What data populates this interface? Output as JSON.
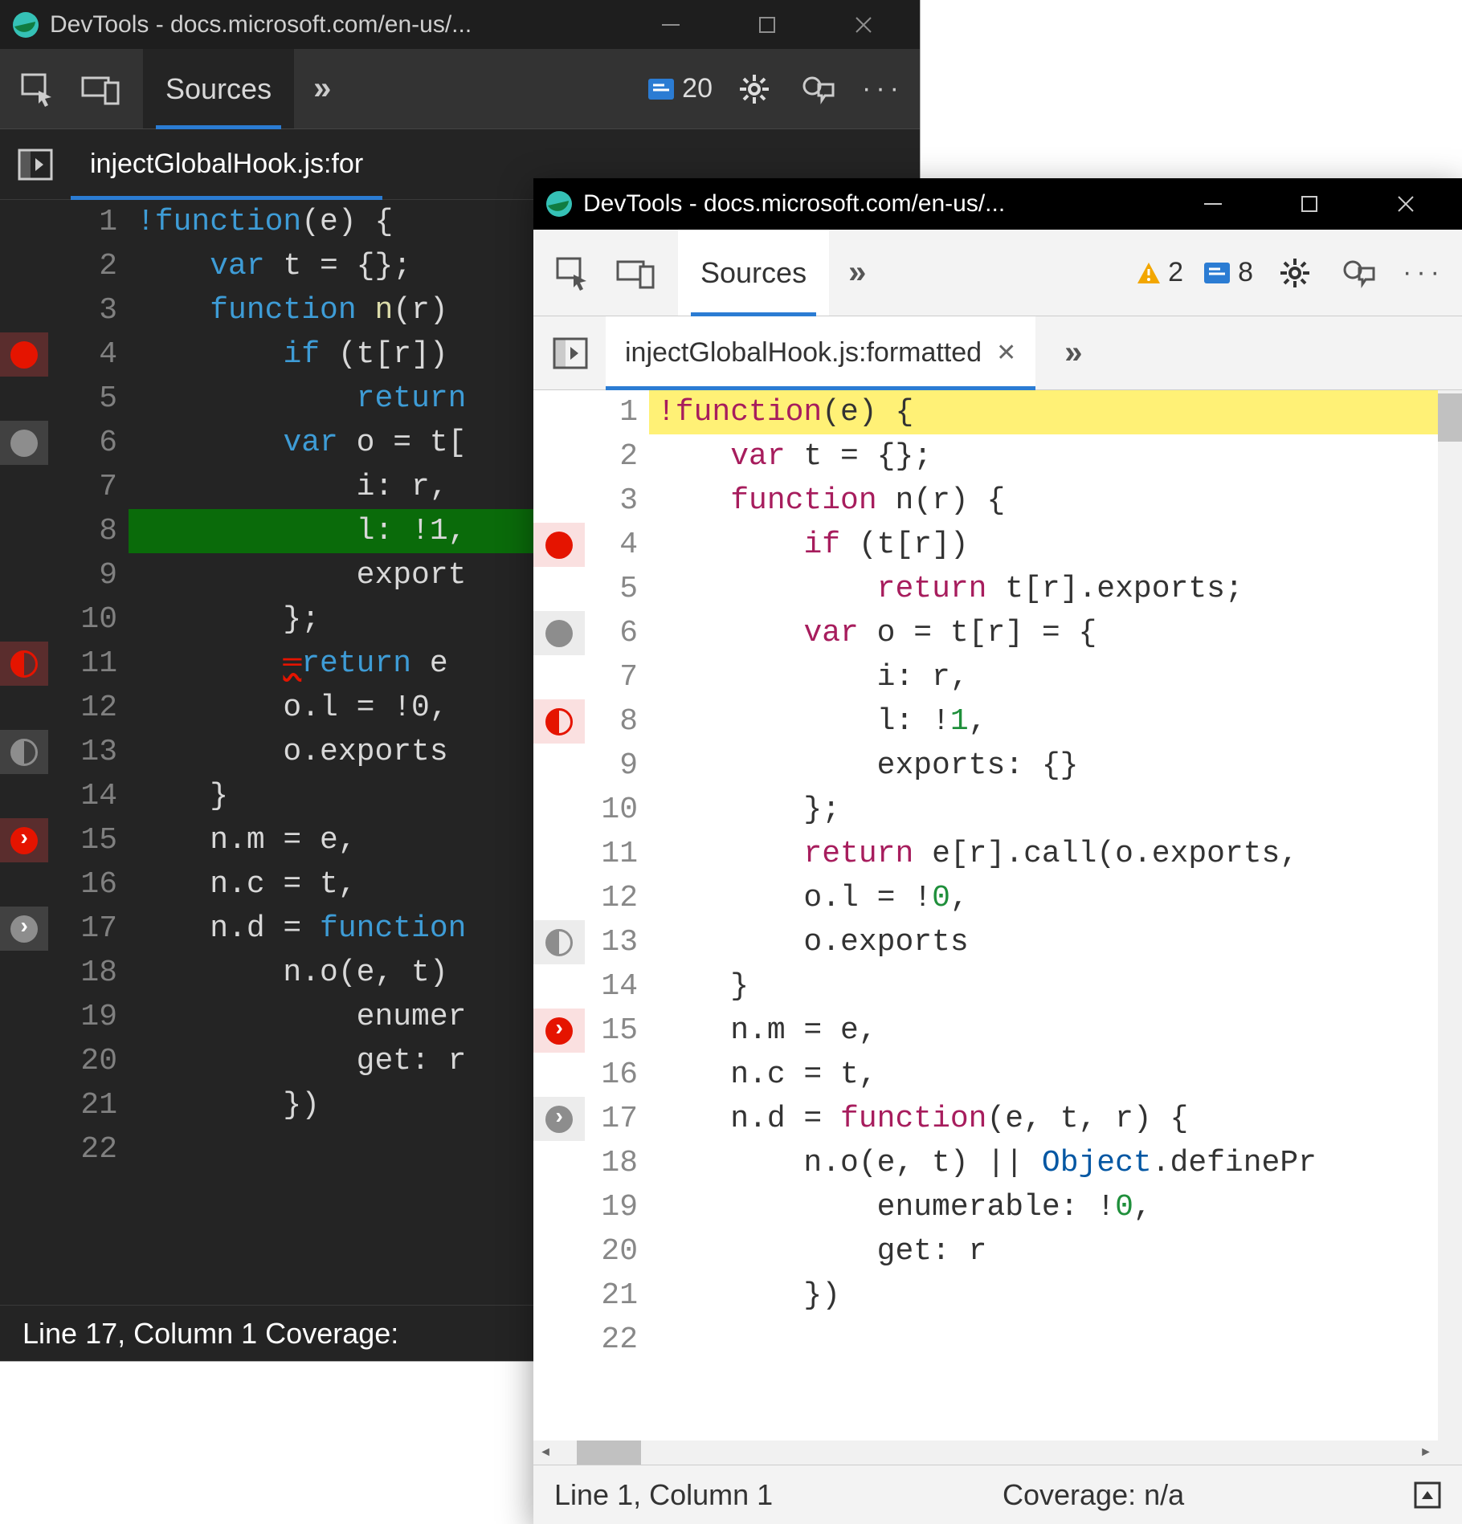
{
  "dark": {
    "title": "DevTools - docs.microsoft.com/en-us/...",
    "toolbar": {
      "sources_tab": "Sources",
      "issues_count": "20"
    },
    "file_tab": "injectGlobalHook.js:for",
    "code": {
      "lines": [
        {
          "n": 1,
          "bp": "",
          "text": "!function(e) {",
          "tokens": [
            [
              "kw",
              "!function"
            ],
            [
              "",
              "(e) {"
            ]
          ]
        },
        {
          "n": 2,
          "bp": "",
          "text": "    var t = {};",
          "tokens": [
            [
              "",
              "    "
            ],
            [
              "kw",
              "var"
            ],
            [
              "",
              " t = {};"
            ]
          ]
        },
        {
          "n": 3,
          "bp": "",
          "text": "    function n(r) ",
          "tokens": [
            [
              "",
              "    "
            ],
            [
              "kw",
              "function"
            ],
            [
              "",
              " "
            ],
            [
              "fn",
              "n"
            ],
            [
              "",
              "(r) "
            ]
          ]
        },
        {
          "n": 4,
          "bp": "red",
          "text": "        if (t[r])",
          "tokens": [
            [
              "",
              "        "
            ],
            [
              "kw",
              "if"
            ],
            [
              "",
              " (t[r])"
            ]
          ]
        },
        {
          "n": 5,
          "bp": "",
          "text": "            return",
          "tokens": [
            [
              "",
              "            "
            ],
            [
              "kw",
              "return"
            ]
          ]
        },
        {
          "n": 6,
          "bp": "grey",
          "text": "        var o = t[",
          "tokens": [
            [
              "",
              "        "
            ],
            [
              "kw",
              "var"
            ],
            [
              "",
              " o = t["
            ]
          ]
        },
        {
          "n": 7,
          "bp": "",
          "text": "            i: r,",
          "tokens": [
            [
              "",
              "            i: r,"
            ]
          ]
        },
        {
          "n": 8,
          "bp": "",
          "exec": true,
          "text": "            l: !1,",
          "tokens": [
            [
              "",
              "            l: !1,"
            ]
          ]
        },
        {
          "n": 9,
          "bp": "",
          "text": "            export",
          "tokens": [
            [
              "",
              "            export"
            ]
          ]
        },
        {
          "n": 10,
          "bp": "",
          "text": "        };",
          "tokens": [
            [
              "",
              "        };"
            ]
          ]
        },
        {
          "n": 11,
          "bp": "half",
          "text": "        ═return e",
          "tokens": [
            [
              "",
              "        "
            ],
            [
              "err",
              "═"
            ],
            [
              "kw",
              "return"
            ],
            [
              "",
              " e"
            ]
          ]
        },
        {
          "n": 12,
          "bp": "",
          "text": "        o.l = !0,",
          "tokens": [
            [
              "",
              "        o.l = !0,"
            ]
          ]
        },
        {
          "n": 13,
          "bp": "half-grey",
          "text": "        o.exports",
          "tokens": [
            [
              "",
              "        o.exports"
            ]
          ]
        },
        {
          "n": 14,
          "bp": "",
          "text": "    }",
          "tokens": [
            [
              "",
              "    }"
            ]
          ]
        },
        {
          "n": 15,
          "bp": "log",
          "text": "    n.m = e,",
          "tokens": [
            [
              "",
              "    n.m = e,"
            ]
          ]
        },
        {
          "n": 16,
          "bp": "",
          "text": "    n.c = t,",
          "tokens": [
            [
              "",
              "    n.c = t,"
            ]
          ]
        },
        {
          "n": 17,
          "bp": "log-grey",
          "text": "    n.d = function",
          "tokens": [
            [
              "",
              "    n.d = "
            ],
            [
              "kw",
              "function"
            ]
          ]
        },
        {
          "n": 18,
          "bp": "",
          "text": "        n.o(e, t)",
          "tokens": [
            [
              "",
              "        n.o(e, t)"
            ]
          ]
        },
        {
          "n": 19,
          "bp": "",
          "text": "            enumer",
          "tokens": [
            [
              "",
              "            enumer"
            ]
          ]
        },
        {
          "n": 20,
          "bp": "",
          "text": "            get: r",
          "tokens": [
            [
              "",
              "            get: r"
            ]
          ]
        },
        {
          "n": 21,
          "bp": "",
          "text": "        })",
          "tokens": [
            [
              "",
              "        })"
            ]
          ]
        },
        {
          "n": 22,
          "bp": "",
          "text": "",
          "tokens": [
            [
              "",
              ""
            ]
          ]
        }
      ]
    },
    "status": "Line 17, Column 1    Coverage:"
  },
  "light": {
    "title": "DevTools - docs.microsoft.com/en-us/...",
    "toolbar": {
      "sources_tab": "Sources",
      "warn_count": "2",
      "issues_count": "8"
    },
    "file_tab": "injectGlobalHook.js:formatted",
    "code": {
      "lines": [
        {
          "n": 1,
          "bp": "",
          "hl": true,
          "text": "!function(e) {",
          "tokens": [
            [
              "kw",
              "!function"
            ],
            [
              "",
              "(e) {"
            ]
          ]
        },
        {
          "n": 2,
          "bp": "",
          "text": "    var t = {};",
          "tokens": [
            [
              "",
              "    "
            ],
            [
              "kw",
              "var"
            ],
            [
              "",
              " t = {};"
            ]
          ]
        },
        {
          "n": 3,
          "bp": "",
          "text": "    function n(r) {",
          "tokens": [
            [
              "",
              "    "
            ],
            [
              "kw",
              "function"
            ],
            [
              "",
              " n(r) {"
            ]
          ]
        },
        {
          "n": 4,
          "bp": "red",
          "text": "        if (t[r])",
          "tokens": [
            [
              "",
              "        "
            ],
            [
              "kw",
              "if"
            ],
            [
              "",
              " (t[r])"
            ]
          ]
        },
        {
          "n": 5,
          "bp": "",
          "text": "            return t[r].exports;",
          "tokens": [
            [
              "",
              "            "
            ],
            [
              "kw",
              "return"
            ],
            [
              "",
              " t[r].exports;"
            ]
          ]
        },
        {
          "n": 6,
          "bp": "grey",
          "text": "        var o = t[r] = {",
          "tokens": [
            [
              "",
              "        "
            ],
            [
              "kw",
              "var"
            ],
            [
              "",
              " o = t[r] = {"
            ]
          ]
        },
        {
          "n": 7,
          "bp": "",
          "text": "            i: r,",
          "tokens": [
            [
              "",
              "            i: r,"
            ]
          ]
        },
        {
          "n": 8,
          "bp": "half",
          "text": "            l: !1,",
          "tokens": [
            [
              "",
              "            l: !"
            ],
            [
              "num",
              "1"
            ],
            [
              "",
              ","
            ]
          ]
        },
        {
          "n": 9,
          "bp": "",
          "text": "            exports: {}",
          "tokens": [
            [
              "",
              "            exports: {}"
            ]
          ]
        },
        {
          "n": 10,
          "bp": "",
          "text": "        };",
          "tokens": [
            [
              "",
              "        };"
            ]
          ]
        },
        {
          "n": 11,
          "bp": "",
          "text": "        return e[r].call(o.exports,",
          "tokens": [
            [
              "",
              "        "
            ],
            [
              "kw",
              "return"
            ],
            [
              "",
              " e[r].call(o.exports,"
            ]
          ]
        },
        {
          "n": 12,
          "bp": "",
          "text": "        o.l = !0,",
          "tokens": [
            [
              "",
              "        o.l = !"
            ],
            [
              "num",
              "0"
            ],
            [
              "",
              ","
            ]
          ]
        },
        {
          "n": 13,
          "bp": "half-grey",
          "text": "        o.exports",
          "tokens": [
            [
              "",
              "        o.exports"
            ]
          ]
        },
        {
          "n": 14,
          "bp": "",
          "text": "    }",
          "tokens": [
            [
              "",
              "    }"
            ]
          ]
        },
        {
          "n": 15,
          "bp": "log",
          "text": "    n.m = e,",
          "tokens": [
            [
              "",
              "    n.m = e,"
            ]
          ]
        },
        {
          "n": 16,
          "bp": "",
          "text": "    n.c = t,",
          "tokens": [
            [
              "",
              "    n.c = t,"
            ]
          ]
        },
        {
          "n": 17,
          "bp": "log-grey",
          "text": "    n.d = function(e, t, r) {",
          "tokens": [
            [
              "",
              "    n.d = "
            ],
            [
              "kw",
              "function"
            ],
            [
              "",
              "(e, t, r) {"
            ]
          ]
        },
        {
          "n": 18,
          "bp": "",
          "text": "        n.o(e, t) || Object.definePr",
          "tokens": [
            [
              "",
              "        n.o(e, t) || "
            ],
            [
              "id",
              "Object"
            ],
            [
              "",
              ".definePr"
            ]
          ]
        },
        {
          "n": 19,
          "bp": "",
          "text": "            enumerable: !0,",
          "tokens": [
            [
              "",
              "            enumerable: !"
            ],
            [
              "num",
              "0"
            ],
            [
              "",
              ","
            ]
          ]
        },
        {
          "n": 20,
          "bp": "",
          "text": "            get: r",
          "tokens": [
            [
              "",
              "            get: r"
            ]
          ]
        },
        {
          "n": 21,
          "bp": "",
          "text": "        })",
          "tokens": [
            [
              "",
              "        })"
            ]
          ]
        },
        {
          "n": 22,
          "bp": "",
          "text": "",
          "tokens": [
            [
              "",
              ""
            ]
          ]
        }
      ]
    },
    "status_left": "Line 1, Column 1",
    "status_right": "Coverage: n/a"
  }
}
